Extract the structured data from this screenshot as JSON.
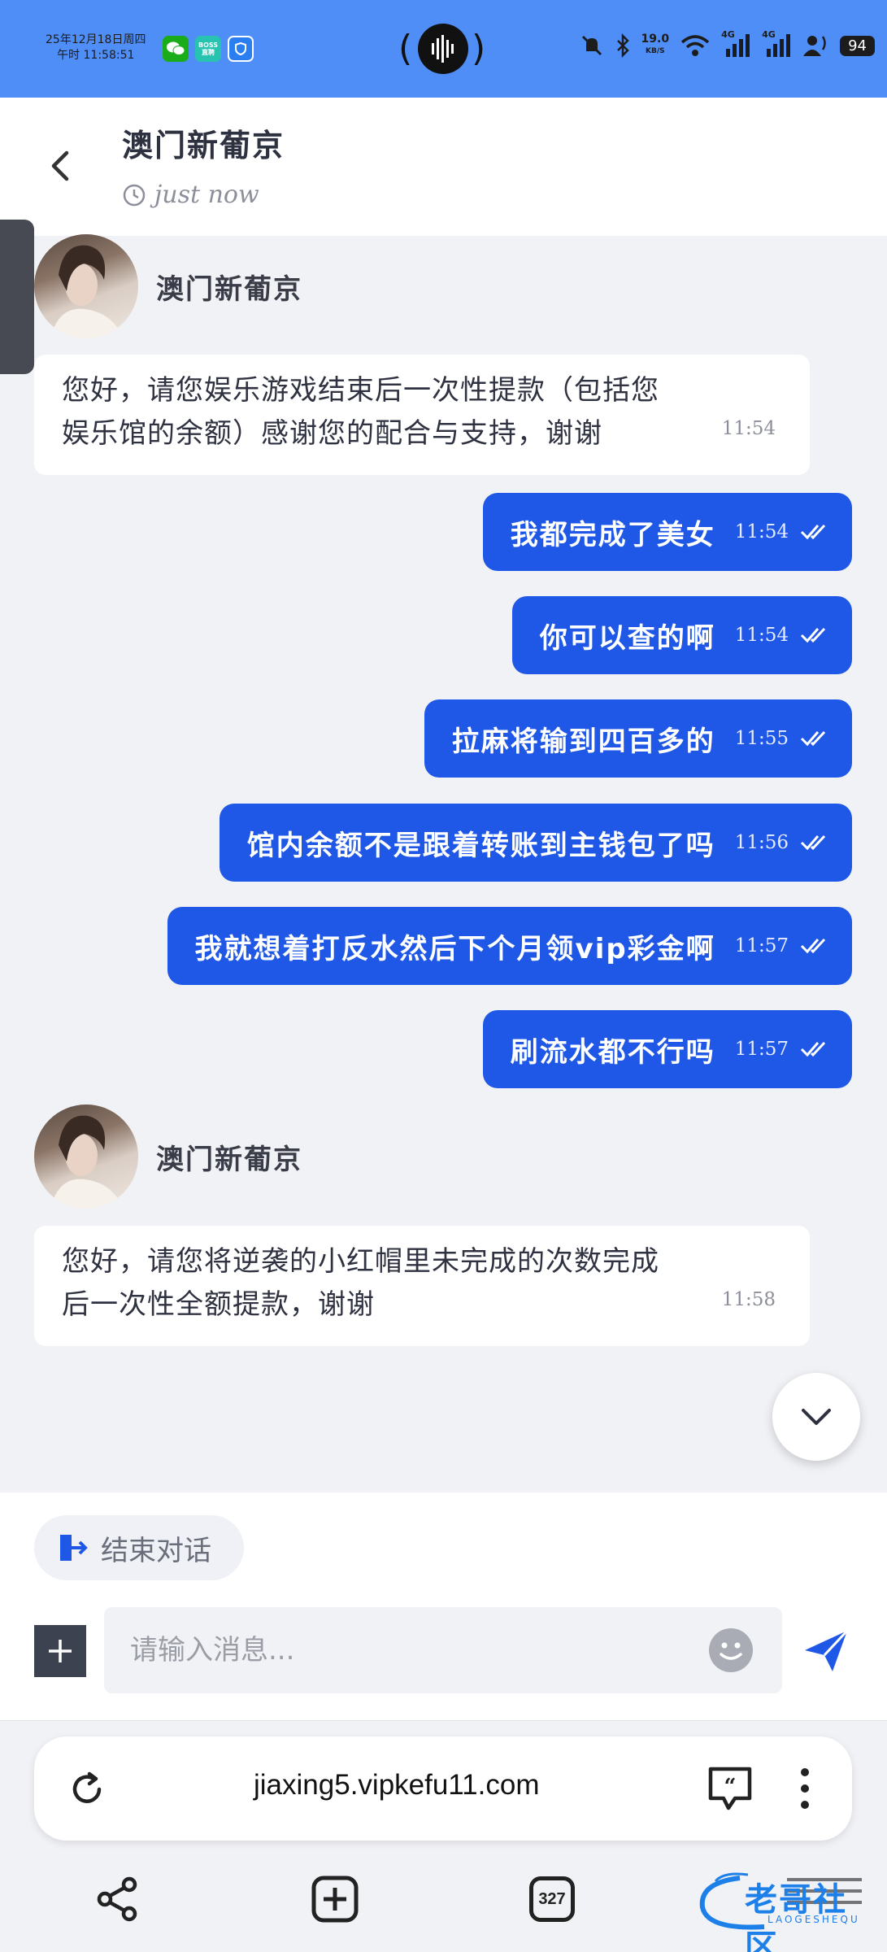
{
  "status_bar": {
    "date": "25年12月18日周四",
    "time": "午时 11:58:51",
    "app_boss": "BOSS\n直聘",
    "net_speed": "19.0",
    "net_unit": "KB/S",
    "sig1": "4G",
    "sig2": "4G",
    "battery": "94"
  },
  "header": {
    "title": "澳门新葡京",
    "status": "just now"
  },
  "messages": {
    "agent_name_1": "澳门新葡京",
    "in_1": {
      "line1": "您好，请您娱乐游戏结束后一次性提款（包括您",
      "line2": "娱乐馆的余额）感谢您的配合与支持，谢谢",
      "time": "11:54"
    },
    "out": [
      {
        "text": "我都完成了美女",
        "time": "11:54"
      },
      {
        "text": "你可以查的啊",
        "time": "11:54"
      },
      {
        "text": "拉麻将输到四百多的",
        "time": "11:55"
      },
      {
        "text": "馆内余额不是跟着转账到主钱包了吗",
        "time": "11:56"
      },
      {
        "text": "我就想着打反水然后下个月领vip彩金啊",
        "time": "11:57"
      },
      {
        "text": "刷流水都不行吗",
        "time": "11:57"
      }
    ],
    "agent_name_2": "澳门新葡京",
    "in_2": {
      "line1": "您好，请您将逆袭的小红帽里未完成的次数完成",
      "line2": "后一次性全额提款，谢谢",
      "time": "11:58"
    }
  },
  "composer": {
    "end_chat_label": "结束对话",
    "input_placeholder": "请输入消息..."
  },
  "browser": {
    "url": "jiaxing5.vipkefu11.com",
    "tab_count": "327"
  },
  "watermark": {
    "text": "老哥社区",
    "sub": "LAOGESHEQU"
  },
  "colors": {
    "status_bar_bg": "#4f8ef7",
    "outgoing_bubble": "#1f57e7",
    "background": "#f1f2f6"
  }
}
